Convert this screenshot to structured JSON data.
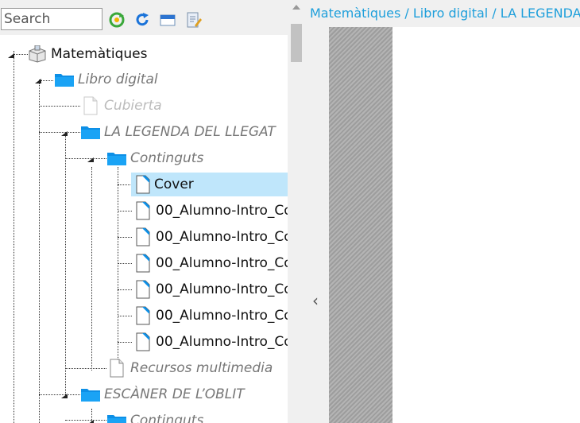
{
  "search": {
    "placeholder": "Search"
  },
  "toolbar": [
    {
      "name": "refresh-green-icon"
    },
    {
      "name": "reload-icon"
    },
    {
      "name": "window-icon"
    },
    {
      "name": "edit-document-icon"
    }
  ],
  "tree": {
    "root": "Matemàtiques",
    "libro": "Libro digital",
    "cubierta": "Cubierta",
    "legenda": "LA LEGENDA DEL LLEGAT",
    "continguts": "Continguts",
    "items": [
      "Cover",
      "00_Alumno-Intro_Co",
      "00_Alumno-Intro_Co",
      "00_Alumno-Intro_Co",
      "00_Alumno-Intro_Co",
      "00_Alumno-Intro_Co",
      "00_Alumno-Intro_Co"
    ],
    "recursos": "Recursos multimedia",
    "escaner": "ESCÀNER DE L’OBLIT",
    "continguts2": "Continguts"
  },
  "breadcrumb": "Matemàtiques / Libro digital / LA LEGENDA DEL LLEGAT",
  "colors": {
    "accent": "#1e9fdb",
    "selected": "#bfe6fb",
    "folder": "#0d8fe6"
  }
}
